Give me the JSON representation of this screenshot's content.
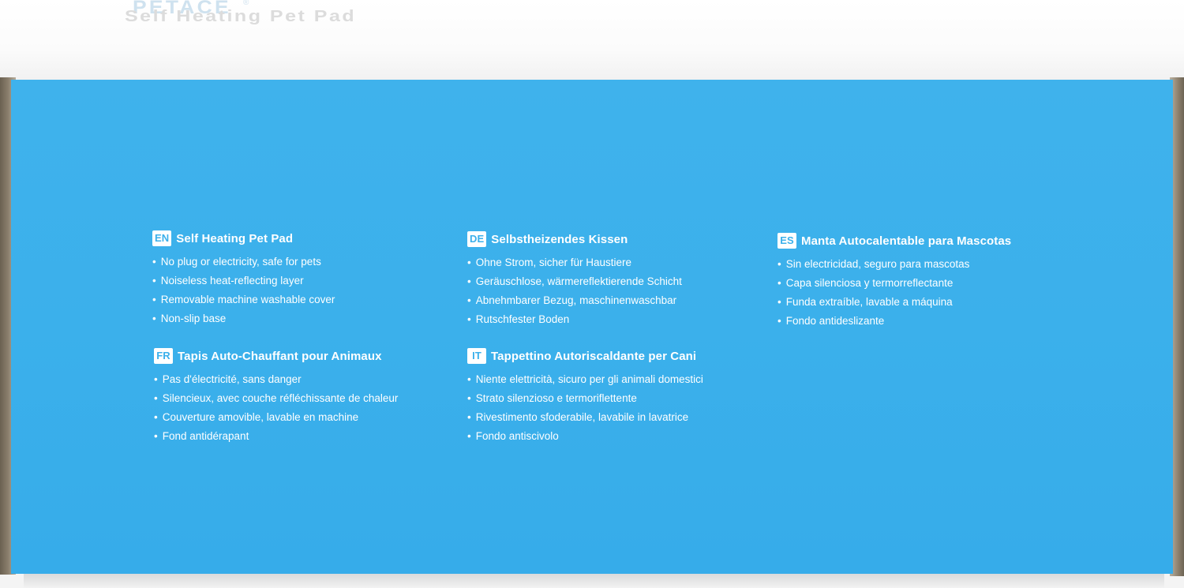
{
  "lid": {
    "brand": "PETACE",
    "registered_mark": "®",
    "product_name": "Self Heating Pet Pad"
  },
  "colors": {
    "box_blue": "#3bb0eb",
    "text_white": "#ffffff"
  },
  "blocks": [
    {
      "lang": "EN",
      "title": "Self Heating Pet Pad",
      "items": [
        "No plug or electricity, safe for pets",
        "Noiseless heat-reflecting layer",
        "Removable machine washable cover",
        "Non-slip base"
      ]
    },
    {
      "lang": "DE",
      "title": "Selbstheizendes Kissen",
      "items": [
        "Ohne Strom, sicher für Haustiere",
        "Geräuschlose, wärmereflektierende Schicht",
        "Abnehmbarer Bezug, maschinenwaschbar",
        "Rutschfester Boden"
      ]
    },
    {
      "lang": "ES",
      "title": "Manta Autocalentable para Mascotas",
      "items": [
        "Sin electricidad, seguro para mascotas",
        "Capa silenciosa y termorreflectante",
        "Funda extraíble, lavable a máquina",
        "Fondo antideslizante"
      ]
    },
    {
      "lang": "FR",
      "title": "Tapis Auto-Chauffant pour Animaux",
      "items": [
        "Pas d'électricité, sans danger",
        "Silencieux, avec couche réfléchissante de chaleur",
        "Couverture amovible, lavable en machine",
        "Fond antidérapant"
      ]
    },
    {
      "lang": "IT",
      "title": "Tappettino Autoriscaldante per Cani",
      "items": [
        "Niente elettricità, sicuro per gli animali domestici",
        "Strato silenzioso e termoriflettente",
        "Rivestimento sfoderabile, lavabile in lavatrice",
        "Fondo antiscivolo"
      ]
    }
  ]
}
